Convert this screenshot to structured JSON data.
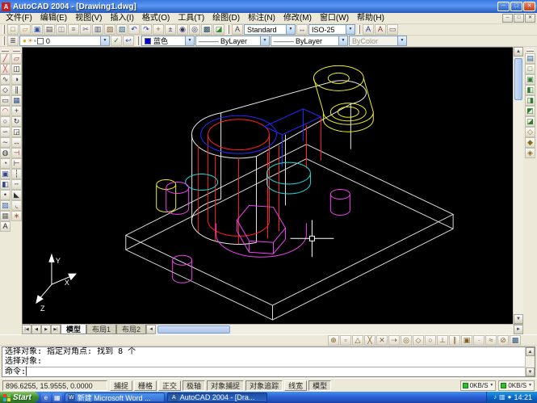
{
  "icons": {
    "dropdown": "▼",
    "scroll_up": "▲",
    "scroll_down": "▼",
    "scroll_left": "◄",
    "scroll_right": "►",
    "caret": "▏"
  },
  "titlebar": {
    "app_icon": "A",
    "title": "AutoCAD 2004 - [Drawing1.dwg]",
    "minimize_glyph": "─",
    "maximize_glyph": "□",
    "close_glyph": "✕"
  },
  "menubar": {
    "items": [
      {
        "name": "menu-file",
        "label": "文件(F)"
      },
      {
        "name": "menu-edit",
        "label": "编辑(E)"
      },
      {
        "name": "menu-view",
        "label": "视图(V)"
      },
      {
        "name": "menu-insert",
        "label": "插入(I)"
      },
      {
        "name": "menu-format",
        "label": "格式(O)"
      },
      {
        "name": "menu-tools",
        "label": "工具(T)"
      },
      {
        "name": "menu-draw",
        "label": "绘图(D)"
      },
      {
        "name": "menu-dimension",
        "label": "标注(N)"
      },
      {
        "name": "menu-modify",
        "label": "修改(M)"
      },
      {
        "name": "menu-window",
        "label": "窗口(W)"
      },
      {
        "name": "menu-help",
        "label": "帮助(H)"
      }
    ],
    "child_min": "─",
    "child_restore": "□",
    "child_close": "✕"
  },
  "standard_toolbar": {
    "icons": [
      {
        "name": "new-drawing-icon",
        "glyph": "□",
        "color": "#7a6a2a"
      },
      {
        "name": "open-icon",
        "glyph": "▱",
        "color": "#c79a1e"
      },
      {
        "name": "save-icon",
        "glyph": "▣",
        "color": "#2d55a0"
      },
      {
        "name": "plot-icon",
        "glyph": "▤",
        "color": "#555555"
      },
      {
        "name": "plot-preview-icon",
        "glyph": "◫",
        "color": "#777777"
      },
      {
        "name": "publish-icon",
        "glyph": "≡",
        "color": "#777777"
      },
      {
        "name": "cut-icon",
        "glyph": "✂",
        "color": "#555577"
      },
      {
        "name": "copy-icon",
        "glyph": "▥",
        "color": "#445577"
      },
      {
        "name": "paste-icon",
        "glyph": "▨",
        "color": "#886633"
      },
      {
        "name": "match-properties-icon",
        "glyph": "▧",
        "color": "#336688"
      },
      {
        "name": "undo-icon",
        "glyph": "↶",
        "color": "#2233cc"
      },
      {
        "name": "redo-icon",
        "glyph": "↷",
        "color": "#2233cc"
      },
      {
        "name": "pan-icon",
        "glyph": "+",
        "color": "#995522"
      },
      {
        "name": "zoom-realtime-icon",
        "glyph": "±",
        "color": "#333366"
      },
      {
        "name": "zoom-window-icon",
        "glyph": "◉",
        "color": "#333366"
      },
      {
        "name": "zoom-previous-icon",
        "glyph": "◎",
        "color": "#333366"
      },
      {
        "name": "properties-icon",
        "glyph": "▩",
        "color": "#224466"
      },
      {
        "name": "designcenter-icon",
        "glyph": "◪",
        "color": "#338833"
      }
    ],
    "text_style_icon": "A",
    "text_style_value": "Standard",
    "dim_style_icon": "↔",
    "dim_style_value": "ISO-25",
    "tail_icons": [
      {
        "name": "text-style-manager-icon",
        "glyph": "A",
        "color": "#223388"
      },
      {
        "name": "dim-style-manager-icon",
        "glyph": "A",
        "color": "#883322"
      },
      {
        "name": "layout-viewport-icon",
        "glyph": "▭",
        "color": "#555555"
      }
    ]
  },
  "layers_toolbar": {
    "layers_manager_icon": "≣",
    "layer_combo": {
      "bulb_glyph": "●",
      "sun_glyph": "☀",
      "lock_glyph": "▪",
      "swatch_style": "background:#ffffff",
      "layer_name": "0"
    },
    "make_current_icon": "✓",
    "layer_previous_icon": "↩",
    "color_combo": {
      "swatch_style": "background:#0000d0",
      "value": "蓝色"
    },
    "linetype_combo": {
      "line_glyph": "———",
      "value": "ByLayer"
    },
    "lineweight_combo": {
      "line_glyph": "———",
      "value": "ByLayer"
    },
    "plotstyle_combo": {
      "value": "ByColor"
    }
  },
  "draw_toolbar": {
    "icons": [
      {
        "name": "line-icon",
        "glyph": "╱",
        "color": "#cc2222"
      },
      {
        "name": "construction-line-icon",
        "glyph": "╳",
        "color": "#cc4444"
      },
      {
        "name": "polyline-icon",
        "glyph": "∿",
        "color": "#333333"
      },
      {
        "name": "polygon-icon",
        "glyph": "◇",
        "color": "#333333"
      },
      {
        "name": "rectangle-icon",
        "glyph": "▭",
        "color": "#333333"
      },
      {
        "name": "arc-icon",
        "glyph": "◠",
        "color": "#cc2222"
      },
      {
        "name": "circle-icon",
        "glyph": "○",
        "color": "#333333"
      },
      {
        "name": "revcloud-icon",
        "glyph": "∽",
        "color": "#333333"
      },
      {
        "name": "spline-icon",
        "glyph": "∼",
        "color": "#333333"
      },
      {
        "name": "ellipse-icon",
        "glyph": "◍",
        "color": "#333333"
      },
      {
        "name": "ellipse-arc-icon",
        "glyph": "◔",
        "color": "#333333"
      },
      {
        "name": "insert-block-icon",
        "glyph": "▣",
        "color": "#334488"
      },
      {
        "name": "make-block-icon",
        "glyph": "◧",
        "color": "#334488"
      },
      {
        "name": "point-icon",
        "glyph": "•",
        "color": "#333333"
      },
      {
        "name": "hatch-icon",
        "glyph": "▨",
        "color": "#3366aa"
      },
      {
        "name": "region-icon",
        "glyph": "▦",
        "color": "#666666"
      },
      {
        "name": "mtext-icon",
        "glyph": "A",
        "color": "#222222"
      }
    ]
  },
  "modify_toolbar": {
    "icons": [
      {
        "name": "erase-icon",
        "glyph": "▱",
        "color": "#aa3333"
      },
      {
        "name": "copy-object-icon",
        "glyph": "◫",
        "color": "#333333"
      },
      {
        "name": "mirror-icon",
        "glyph": "◑",
        "color": "#333333"
      },
      {
        "name": "offset-icon",
        "glyph": "∥",
        "color": "#333333"
      },
      {
        "name": "array-icon",
        "glyph": "▦",
        "color": "#335588"
      },
      {
        "name": "move-icon",
        "glyph": "+",
        "color": "#333333"
      },
      {
        "name": "rotate-icon",
        "glyph": "↻",
        "color": "#333333"
      },
      {
        "name": "scale-icon",
        "glyph": "◲",
        "color": "#333333"
      },
      {
        "name": "stretch-icon",
        "glyph": "↔",
        "color": "#333333"
      },
      {
        "name": "trim-icon",
        "glyph": "⊣",
        "color": "#aa3333"
      },
      {
        "name": "extend-icon",
        "glyph": "⊢",
        "color": "#333333"
      },
      {
        "name": "break-at-point-icon",
        "glyph": "┆",
        "color": "#333333"
      },
      {
        "name": "break-icon",
        "glyph": "╌",
        "color": "#333333"
      },
      {
        "name": "chamfer-icon",
        "glyph": "◣",
        "color": "#333333"
      },
      {
        "name": "fillet-icon",
        "glyph": "◟",
        "color": "#333333"
      },
      {
        "name": "explode-icon",
        "glyph": "∗",
        "color": "#aa5522"
      }
    ]
  },
  "view_toolbar": {
    "icons": [
      {
        "name": "named-views-icon",
        "glyph": "▤",
        "color": "#336699"
      },
      {
        "name": "top-view-icon",
        "glyph": "□",
        "color": "#2f7d32"
      },
      {
        "name": "bottom-view-icon",
        "glyph": "▣",
        "color": "#2f7d32"
      },
      {
        "name": "left-view-icon",
        "glyph": "◧",
        "color": "#2f7d32"
      },
      {
        "name": "right-view-icon",
        "glyph": "◨",
        "color": "#2f7d32"
      },
      {
        "name": "front-view-icon",
        "glyph": "◩",
        "color": "#2f7d32"
      },
      {
        "name": "back-view-icon",
        "glyph": "◪",
        "color": "#2f7d32"
      },
      {
        "name": "sw-isometric-icon",
        "glyph": "◇",
        "color": "#8a6d1a"
      },
      {
        "name": "se-isometric-icon",
        "glyph": "◆",
        "color": "#8a6d1a"
      },
      {
        "name": "ne-isometric-icon",
        "glyph": "◈",
        "color": "#8a6d1a"
      }
    ]
  },
  "osnap_toolbar": {
    "icons": [
      {
        "name": "snap-from-icon",
        "glyph": "⊕",
        "color": "#806020"
      },
      {
        "name": "snap-endpoint-icon",
        "glyph": "▫",
        "color": "#806020"
      },
      {
        "name": "snap-midpoint-icon",
        "glyph": "△",
        "color": "#806020"
      },
      {
        "name": "snap-intersection-icon",
        "glyph": "╳",
        "color": "#806020"
      },
      {
        "name": "snap-apparent-intersection-icon",
        "glyph": "✕",
        "color": "#806020"
      },
      {
        "name": "snap-extension-icon",
        "glyph": "⇢",
        "color": "#806020"
      },
      {
        "name": "snap-center-icon",
        "glyph": "◎",
        "color": "#806020"
      },
      {
        "name": "snap-quadrant-icon",
        "glyph": "◇",
        "color": "#806020"
      },
      {
        "name": "snap-tangent-icon",
        "glyph": "○",
        "color": "#806020"
      },
      {
        "name": "snap-perpendicular-icon",
        "glyph": "⊥",
        "color": "#806020"
      },
      {
        "name": "snap-parallel-icon",
        "glyph": "∥",
        "color": "#806020"
      },
      {
        "name": "snap-insert-icon",
        "glyph": "▣",
        "color": "#806020"
      },
      {
        "name": "snap-node-icon",
        "glyph": "∙",
        "color": "#806020"
      },
      {
        "name": "snap-nearest-icon",
        "glyph": "≈",
        "color": "#806020"
      },
      {
        "name": "snap-none-icon",
        "glyph": "⊘",
        "color": "#806020"
      },
      {
        "name": "osnap-settings-icon",
        "glyph": "▩",
        "color": "#335577"
      }
    ]
  },
  "canvas": {
    "ucs_x": "X",
    "ucs_y": "Y",
    "ucs_z": "Z"
  },
  "layout_tabs": {
    "nav": [
      {
        "name": "tab-first-button",
        "glyph": "|◀"
      },
      {
        "name": "tab-prev-button",
        "glyph": "◀"
      },
      {
        "name": "tab-next-button",
        "glyph": "▶"
      },
      {
        "name": "tab-last-button",
        "glyph": "▶|"
      }
    ],
    "tabs": [
      {
        "name": "tab-model",
        "label": "模型",
        "active": true
      },
      {
        "name": "tab-layout1",
        "label": "布局1",
        "active": false
      },
      {
        "name": "tab-layout2",
        "label": "布局2",
        "active": false
      }
    ]
  },
  "command_window": {
    "line1": "选择对象: 指定对角点: 找到 8 个",
    "line2": "选择对象:",
    "line3": "命令:"
  },
  "statusbar": {
    "coords": "896.6255, 15.9555, 0.0000",
    "toggles": [
      {
        "name": "snap-toggle",
        "label": "捕捉",
        "pressed": false
      },
      {
        "name": "grid-toggle",
        "label": "栅格",
        "pressed": false
      },
      {
        "name": "ortho-toggle",
        "label": "正交",
        "pressed": false
      },
      {
        "name": "polar-toggle",
        "label": "极轴",
        "pressed": true
      },
      {
        "name": "osnap-toggle",
        "label": "对象捕捉",
        "pressed": true
      },
      {
        "name": "otrack-toggle",
        "label": "对象追踪",
        "pressed": true
      },
      {
        "name": "lineweight-toggle",
        "label": "线宽",
        "pressed": false
      },
      {
        "name": "model-toggle",
        "label": "模型",
        "pressed": true
      }
    ],
    "net_monitors": [
      {
        "name": "net-download-indicator",
        "label": "0KB/S"
      },
      {
        "name": "net-upload-indicator",
        "label": "0KB/S"
      }
    ]
  },
  "taskbar": {
    "start_label": "Start",
    "quick_launch": [
      {
        "name": "ie-quicklaunch-icon",
        "glyph": "e"
      },
      {
        "name": "show-desktop-icon",
        "glyph": "▦"
      }
    ],
    "tasks": [
      {
        "name": "task-word-document",
        "icon_glyph": "W",
        "label": "新建 Microsoft Word ...",
        "active": false
      },
      {
        "name": "task-autocad",
        "icon_glyph": "A",
        "label": "AutoCAD 2004 - [Dra...",
        "active": true
      }
    ],
    "tray_icons": [
      {
        "name": "volume-tray-icon",
        "glyph": "♪"
      },
      {
        "name": "network-tray-icon",
        "glyph": "▥"
      },
      {
        "name": "antivirus-tray-icon",
        "glyph": "●"
      }
    ],
    "clock": "14:21"
  }
}
